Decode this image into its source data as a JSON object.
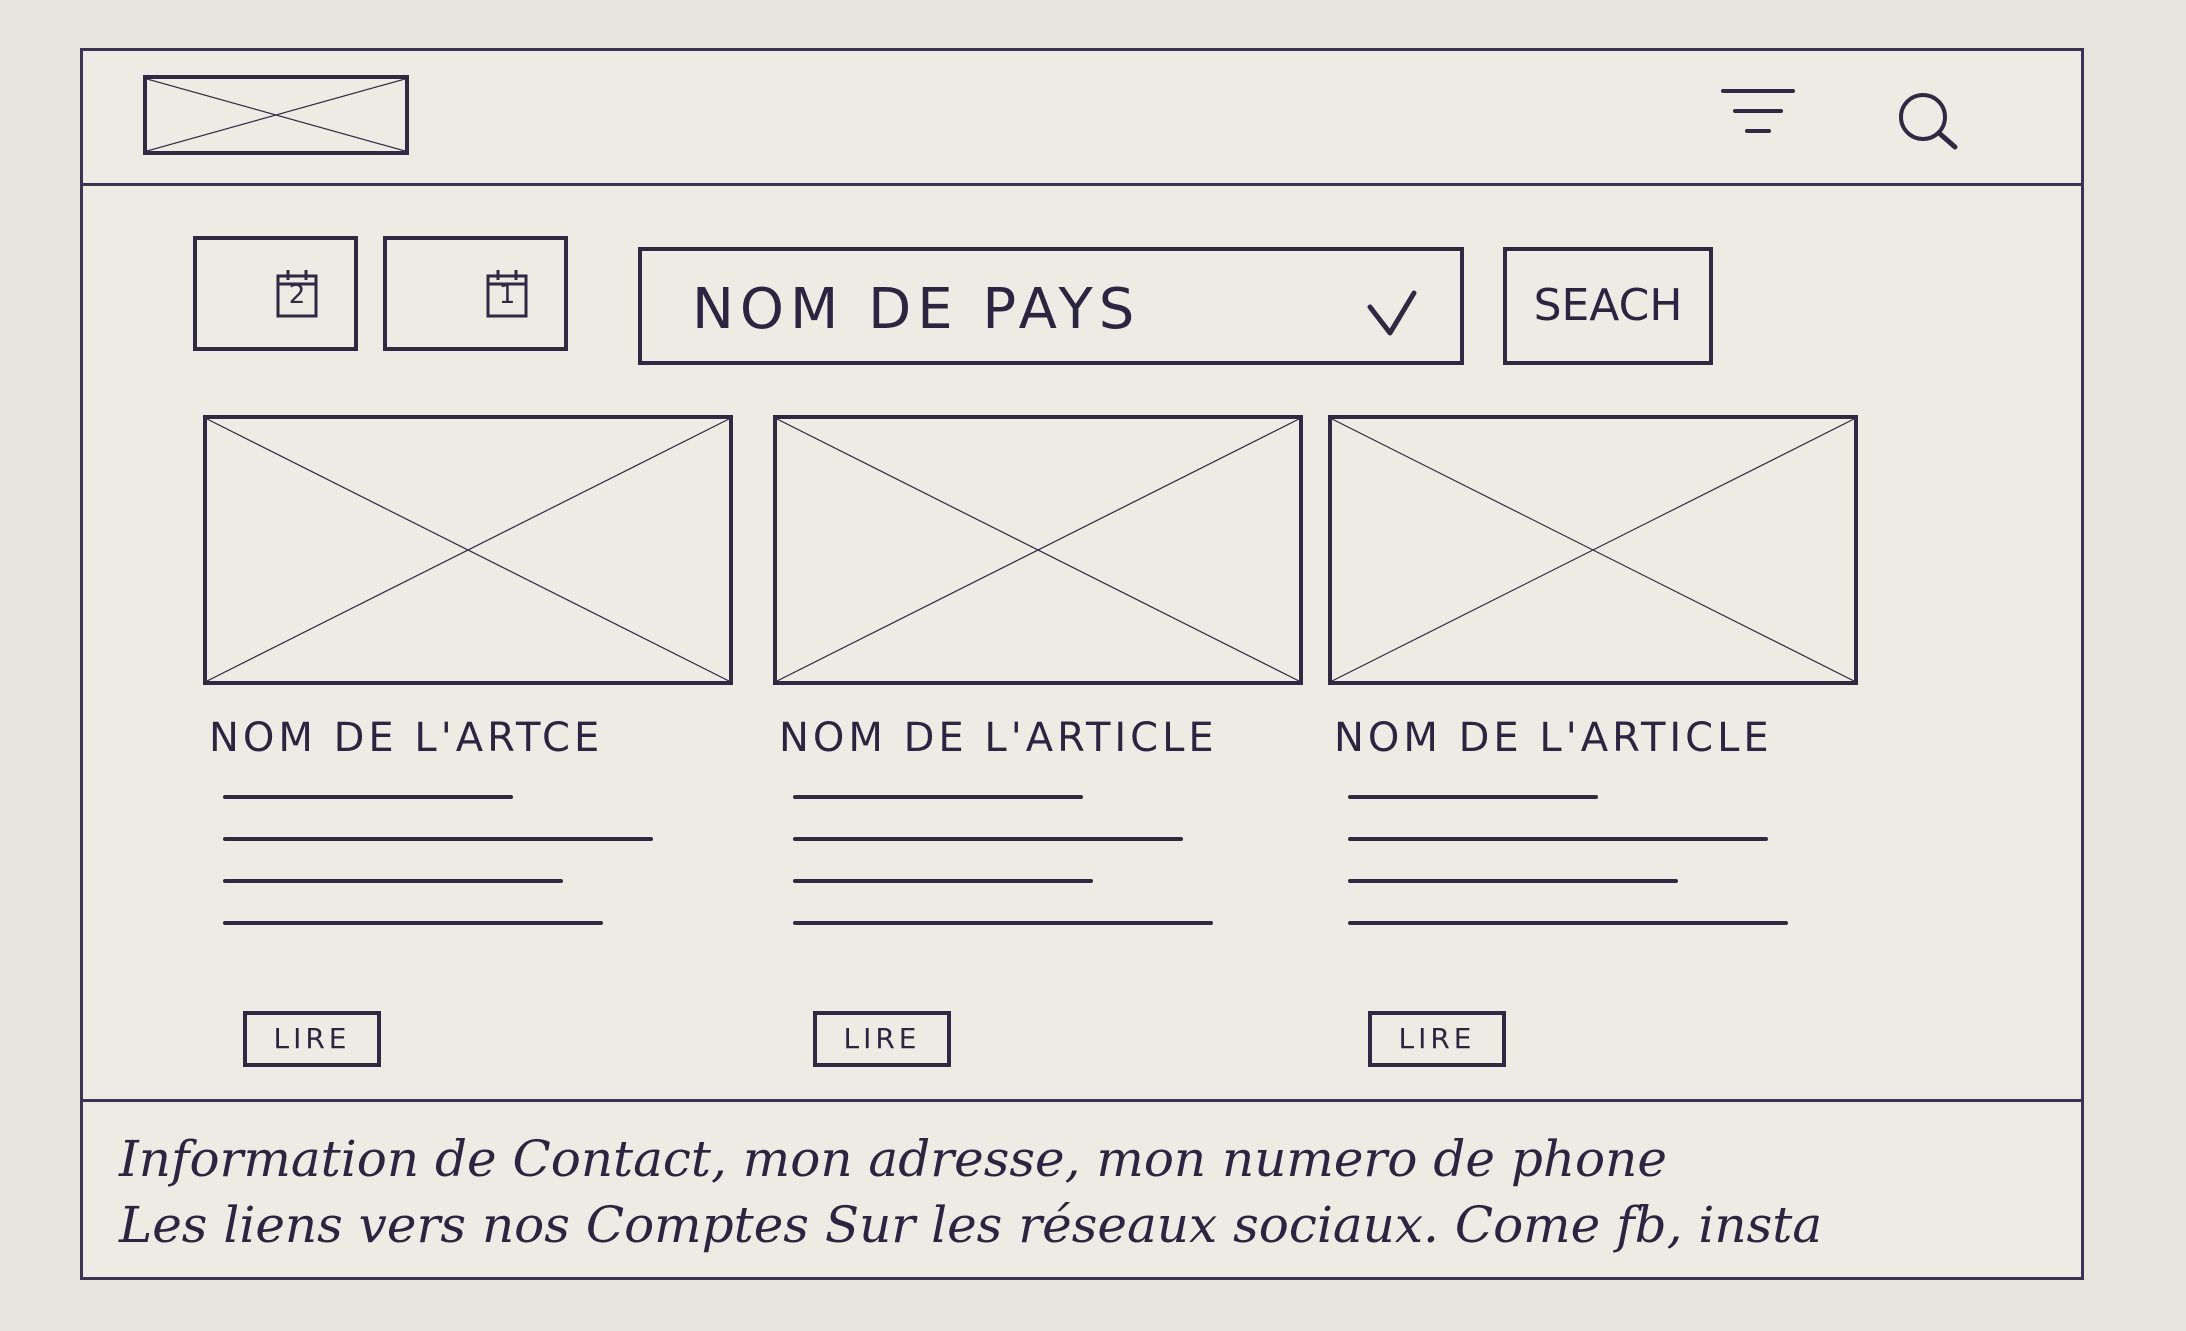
{
  "header": {
    "logo_icon": "image-placeholder-icon",
    "menu_icon": "filter-icon",
    "search_icon": "search-icon"
  },
  "filters": {
    "date_from_day": "2",
    "date_to_day": "1",
    "country_select": {
      "value": "NOM DE PAYS",
      "icon": "chevron-down-icon"
    },
    "search_button_label": "SEACH"
  },
  "articles": [
    {
      "title": "NOM DE L'ARTCE",
      "read_label": "LIRE"
    },
    {
      "title": "NOM DE L'ARTICLE",
      "read_label": "LIRE"
    },
    {
      "title": "NOM DE L'ARTICLE",
      "read_label": "LIRE"
    }
  ],
  "footer": {
    "line1": "Information de Contact, mon adresse, mon numero de phone",
    "line2": "Les liens vers nos Comptes Sur les réseaux sociaux. Come fb, insta"
  },
  "colors": {
    "ink": "#2f2a44",
    "paper": "#ecebe4"
  }
}
